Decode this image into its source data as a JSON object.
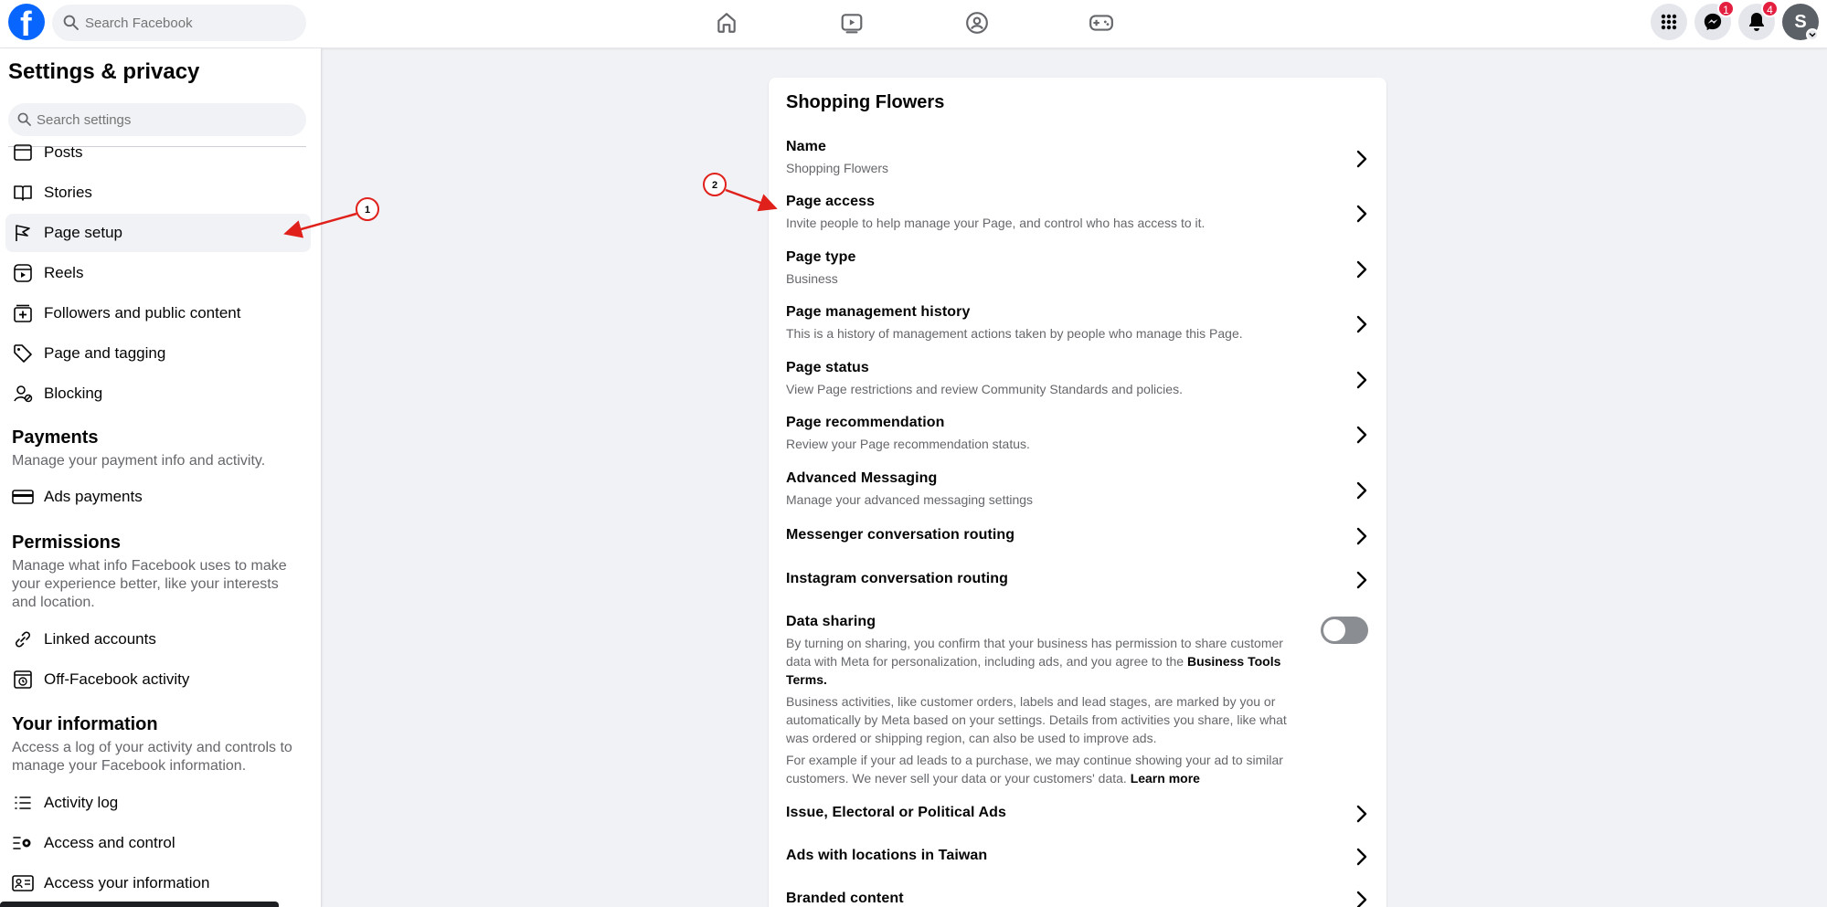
{
  "topbar": {
    "logo": "f",
    "search_placeholder": "Search Facebook",
    "nav_icons": [
      "home-icon",
      "video-icon",
      "groups-icon",
      "gaming-icon"
    ],
    "messenger_badge": "1",
    "notifications_badge": "4",
    "avatar_letter": "S"
  },
  "sidebar": {
    "title": "Settings & privacy",
    "search_placeholder": "Search settings",
    "items": [
      {
        "label": "Posts",
        "icon": "posts-icon"
      },
      {
        "label": "Stories",
        "icon": "stories-icon"
      },
      {
        "label": "Page setup",
        "icon": "flag-icon"
      },
      {
        "label": "Reels",
        "icon": "reels-icon"
      },
      {
        "label": "Followers and public content",
        "icon": "followers-icon"
      },
      {
        "label": "Page and tagging",
        "icon": "tag-icon"
      },
      {
        "label": "Blocking",
        "icon": "blocking-icon"
      }
    ],
    "payments": {
      "heading": "Payments",
      "desc": "Manage your payment info and activity.",
      "items": [
        {
          "label": "Ads payments",
          "icon": "card-icon"
        }
      ]
    },
    "permissions": {
      "heading": "Permissions",
      "desc": "Manage what info Facebook uses to make your experience better, like your interests and location.",
      "items": [
        {
          "label": "Linked accounts",
          "icon": "link-icon"
        },
        {
          "label": "Off-Facebook activity",
          "icon": "history-icon"
        }
      ]
    },
    "your_information": {
      "heading": "Your information",
      "desc": "Access a log of your activity and controls to manage your Facebook information.",
      "items": [
        {
          "label": "Activity log",
          "icon": "list-icon"
        },
        {
          "label": "Access and control",
          "icon": "gear-list-icon"
        },
        {
          "label": "Access your information",
          "icon": "id-card-icon"
        }
      ]
    }
  },
  "main": {
    "title": "Shopping Flowers",
    "rows": [
      {
        "title": "Name",
        "subtitle": "Shopping Flowers"
      },
      {
        "title": "Page access",
        "subtitle": "Invite people to help manage your Page, and control who has access to it."
      },
      {
        "title": "Page type",
        "subtitle": "Business"
      },
      {
        "title": "Page management history",
        "subtitle": "This is a history of management actions taken by people who manage this Page."
      },
      {
        "title": "Page status",
        "subtitle": "View Page restrictions and review Community Standards and policies."
      },
      {
        "title": "Page recommendation",
        "subtitle": "Review your Page recommendation status."
      },
      {
        "title": "Advanced Messaging",
        "subtitle": "Manage your advanced messaging settings"
      },
      {
        "title": "Messenger conversation routing",
        "subtitle": ""
      },
      {
        "title": "Instagram conversation routing",
        "subtitle": ""
      }
    ],
    "data_sharing": {
      "title": "Data sharing",
      "p1": "By turning on sharing, you confirm that your business has permission to share customer data with Meta for personalization, including ads, and you agree to the",
      "p1_link": "Business Tools Terms.",
      "p2": "Business activities, like customer orders, labels and lead stages, are marked by you or automatically by Meta based on your settings. Details from activities you share, like what was ordered or shipping region, can also be used to improve ads.",
      "p3": "For example if your ad leads to a purchase, we may continue showing your ad to similar customers. We never sell your data or your customers' data.",
      "p3_link": "Learn more",
      "toggle_on": false
    },
    "rows_after": [
      {
        "title": "Issue, Electoral or Political Ads"
      },
      {
        "title": "Ads with locations in Taiwan"
      },
      {
        "title": "Branded content"
      }
    ]
  },
  "annotations": {
    "marker_1": "1",
    "marker_2": "2",
    "color": "#e0201b"
  }
}
